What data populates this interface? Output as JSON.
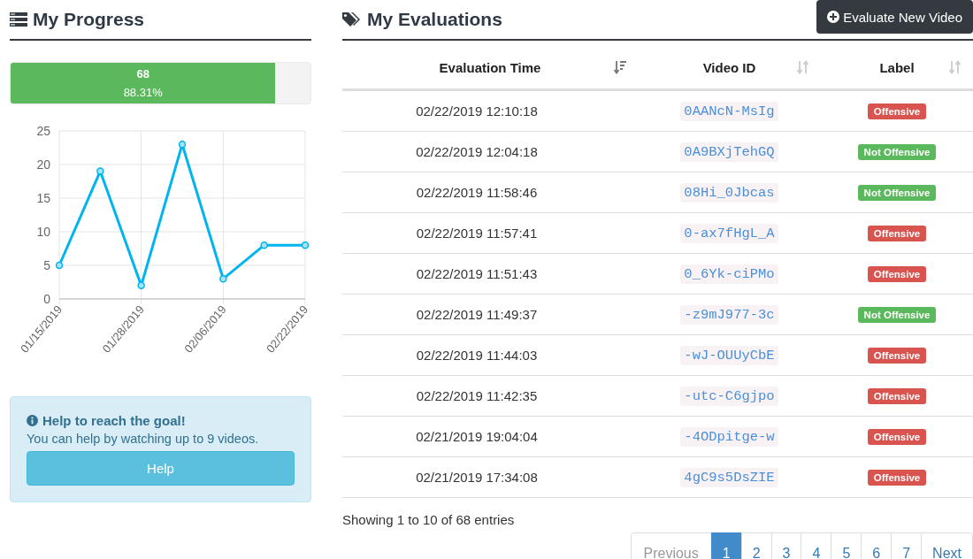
{
  "progress": {
    "title": "My Progress",
    "count": "68",
    "percent": "88.31%",
    "level": 0.8831,
    "chart_data": {
      "type": "line",
      "categories": [
        "01/15/2019",
        null,
        "01/28/2019",
        null,
        "02/06/2019",
        null,
        "02/22/2019"
      ],
      "grid": true,
      "series": [
        {
          "color": "#00b4f0",
          "marker": true,
          "values": [
            5,
            19,
            2,
            23,
            3,
            8,
            8
          ]
        }
      ],
      "ylim": [
        0,
        25
      ],
      "yticks": [
        0,
        5,
        10,
        15,
        20,
        25
      ]
    }
  },
  "goal": {
    "title": "Help to reach the goal!",
    "text": "You can help by watching up to 9 videos.",
    "button": "Help"
  },
  "evaluations": {
    "title": "My Evaluations",
    "new_button": "Evaluate New Video",
    "columns": [
      {
        "label": "Evaluation Time",
        "sorted": true
      },
      {
        "label": "Video ID",
        "sorted": false
      },
      {
        "label": "Label",
        "sorted": false
      }
    ],
    "rows": [
      {
        "time": "02/22/2019 12:10:18",
        "video_id": "0AANcN-MsIg",
        "label": "Offensive",
        "kind": "offensive"
      },
      {
        "time": "02/22/2019 12:04:18",
        "video_id": "0A9BXjTehGQ",
        "label": "Not Offensive",
        "kind": "not_offensive"
      },
      {
        "time": "02/22/2019 11:58:46",
        "video_id": "08Hi_0Jbcas",
        "label": "Not Offensive",
        "kind": "not_offensive"
      },
      {
        "time": "02/22/2019 11:57:41",
        "video_id": "0-ax7fHgL_A",
        "label": "Offensive",
        "kind": "offensive"
      },
      {
        "time": "02/22/2019 11:51:43",
        "video_id": "0_6Yk-ciPMo",
        "label": "Offensive",
        "kind": "offensive"
      },
      {
        "time": "02/22/2019 11:49:37",
        "video_id": "-z9mJ977-3c",
        "label": "Not Offensive",
        "kind": "not_offensive"
      },
      {
        "time": "02/22/2019 11:44:03",
        "video_id": "-wJ-OUUyCbE",
        "label": "Offensive",
        "kind": "offensive"
      },
      {
        "time": "02/22/2019 11:42:35",
        "video_id": "-utc-C6gjpo",
        "label": "Offensive",
        "kind": "offensive"
      },
      {
        "time": "02/21/2019 19:04:04",
        "video_id": "-4ODpitge-w",
        "label": "Offensive",
        "kind": "offensive"
      },
      {
        "time": "02/21/2019 17:34:08",
        "video_id": "4gC9s5DsZIE",
        "label": "Offensive",
        "kind": "offensive"
      }
    ],
    "summary": "Showing 1 to 10 of 68 entries",
    "pagination": [
      {
        "label": "Previous",
        "kind": "prev",
        "selected": false
      },
      {
        "label": "1",
        "kind": "page",
        "selected": true
      },
      {
        "label": "2",
        "kind": "page",
        "selected": false
      },
      {
        "label": "3",
        "kind": "page",
        "selected": false
      },
      {
        "label": "4",
        "kind": "page",
        "selected": false
      },
      {
        "label": "5",
        "kind": "page",
        "selected": false
      },
      {
        "label": "6",
        "kind": "page",
        "selected": false
      },
      {
        "label": "7",
        "kind": "page",
        "selected": false
      },
      {
        "label": "Next",
        "kind": "next",
        "selected": false
      }
    ]
  }
}
